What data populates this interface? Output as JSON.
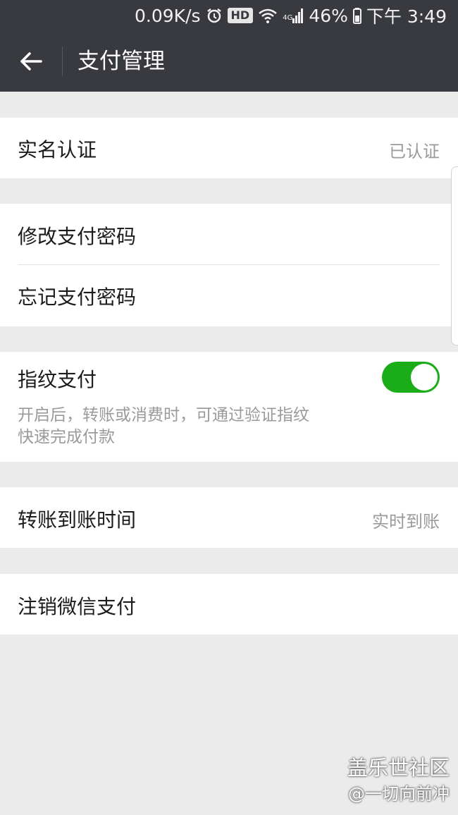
{
  "status_bar": {
    "speed": "0.09K/s",
    "hd_badge": "HD",
    "network": "4G",
    "battery": "46%",
    "time": "下午 3:49"
  },
  "header": {
    "title": "支付管理"
  },
  "rows": {
    "real_name": {
      "label": "实名认证",
      "value": "已认证"
    },
    "change_password": {
      "label": "修改支付密码"
    },
    "forgot_password": {
      "label": "忘记支付密码"
    },
    "fingerprint": {
      "label": "指纹支付",
      "enabled": true,
      "desc_line1": "开启后，转账或消费时，可通过验证指纹",
      "desc_line2": "快速完成付款"
    },
    "transfer_time": {
      "label": "转账到账时间",
      "value": "实时到账"
    },
    "cancel": {
      "label": "注销微信支付"
    }
  },
  "watermark": {
    "line1": "盖乐世社区",
    "line2": "@一切向前冲"
  },
  "colors": {
    "toolbar": "#383a3f",
    "switch_on": "#1aad19",
    "page_bg": "#ebebeb"
  }
}
